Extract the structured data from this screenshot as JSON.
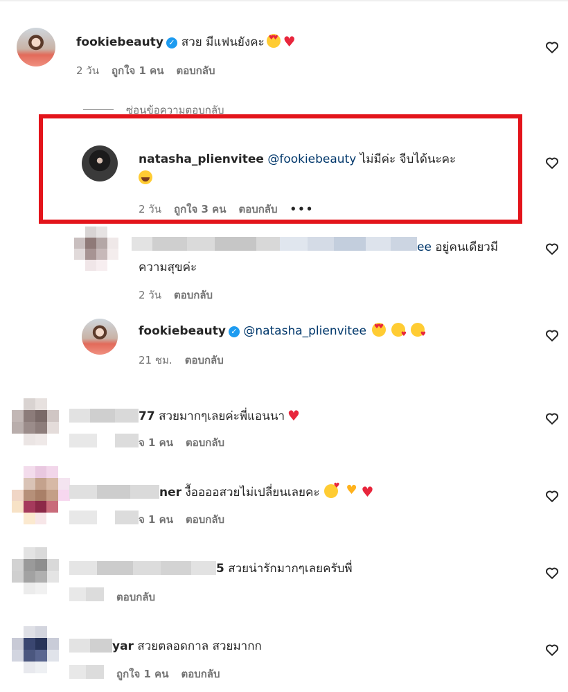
{
  "comments": [
    {
      "username": "fookiebeauty",
      "verified": true,
      "text": "สวย มีแฟนยังคะ",
      "time": "2 วัน",
      "likes": "ถูกใจ 1 คน",
      "reply": "ตอบกลับ"
    },
    {
      "hidden_replies_label": "ซ่อนข้อความตอบกลับ"
    },
    {
      "username": "natasha_plienvitee",
      "mention": "@fookiebeauty",
      "text": "ไม่มีค่ะ จีบได้นะคะ",
      "time": "2 วัน",
      "likes": "ถูกใจ 3 คน",
      "reply": "ตอบกลับ",
      "more": "•••"
    },
    {
      "username_visible_part": "ee",
      "text_line1": "อยู่คนเดียวมี",
      "text_line2": "ความสุขค่ะ",
      "time": "2 วัน",
      "reply": "ตอบกลับ"
    },
    {
      "username": "fookiebeauty",
      "verified": true,
      "mention": "@natasha_plienvitee",
      "time": "21 ชม.",
      "reply": "ตอบกลับ"
    },
    {
      "username_visible_part": "77",
      "text": "สวยมากๆเลยค่ะพี่แอนนา",
      "likes_visible_part": "จ 1 คน",
      "reply": "ตอบกลับ"
    },
    {
      "username_visible_part": "ner",
      "text": "งื้ออออสวยไม่เปลี่ยนเลยคะ",
      "likes_visible_part": "จ 1 คน",
      "reply": "ตอบกลับ"
    },
    {
      "username_visible_part": "5",
      "text": "สวยน่ารักมากๆเลยครับพี่",
      "reply": "ตอบกลับ"
    },
    {
      "username_visible_part": "yar",
      "text": "สวยตลอดกาล สวยมากก",
      "likes": "ถูกใจ 1 คน",
      "reply": "ตอบกลับ"
    }
  ],
  "icons": {
    "like": "heart-outline-icon",
    "verified": "verified-badge-icon"
  },
  "colors": {
    "highlight_box": "#e3141b",
    "mention": "#00376b",
    "verified": "#1d9bf0",
    "muted_text": "#737373"
  }
}
